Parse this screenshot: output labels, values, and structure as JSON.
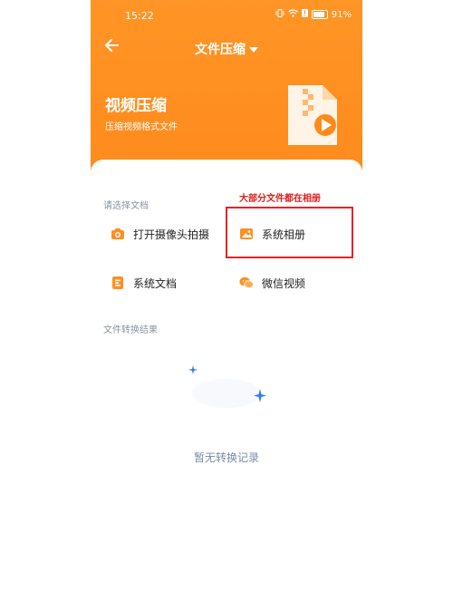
{
  "status_bar": {
    "time": "15:22",
    "battery": "91%",
    "icons": [
      "vibrate-icon",
      "wifi-icon",
      "sim-alert-icon",
      "battery-icon"
    ]
  },
  "nav": {
    "back_icon": "back-arrow-icon",
    "title": "文件压缩",
    "dropdown_icon": "caret-down-icon"
  },
  "hero": {
    "title": "视频压缩",
    "subtitle": "压缩视频格式文件",
    "illustration": "zip-video-file-icon"
  },
  "choose_section": {
    "label": "请选择文档",
    "options": [
      {
        "label": "打开摄像头拍摄",
        "icon": "camera-icon"
      },
      {
        "label": "系统相册",
        "icon": "gallery-icon"
      },
      {
        "label": "系统文档",
        "icon": "document-icon"
      },
      {
        "label": "微信视频",
        "icon": "wechat-icon"
      }
    ]
  },
  "annotation": {
    "note": "大部分文件都在相册",
    "color": "#e01e1e"
  },
  "result_section": {
    "label": "文件转换结果",
    "empty_text": "暂无转换记录"
  },
  "colors": {
    "primary": "#ff8f21",
    "accent_blue": "#2f7df6",
    "annotation_red": "#e2242a"
  }
}
